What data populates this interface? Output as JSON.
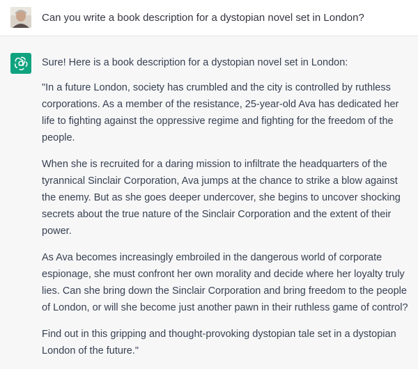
{
  "user_message": {
    "avatar_icon": "user-avatar-photo",
    "text": "Can you write a book description for a dystopian novel set in London?"
  },
  "assistant_message": {
    "avatar_icon": "openai-logo-icon",
    "avatar_color": "#10a37f",
    "intro": "Sure! Here is a book description for a dystopian novel set in London:",
    "paragraphs": [
      "\"In a future London, society has crumbled and the city is controlled by ruthless corporations. As a member of the resistance, 25-year-old Ava has dedicated her life to fighting against the oppressive regime and fighting for the freedom of the people.",
      "When she is recruited for a daring mission to infiltrate the headquarters of the tyrannical Sinclair Corporation, Ava jumps at the chance to strike a blow against the enemy. But as she goes deeper undercover, she begins to uncover shocking secrets about the true nature of the Sinclair Corporation and the extent of their power.",
      "As Ava becomes increasingly embroiled in the dangerous world of corporate espionage, she must confront her own morality and decide where her loyalty truly lies. Can she bring down the Sinclair Corporation and bring freedom to the people of London, or will she become just another pawn in their ruthless game of control?",
      "Find out in this gripping and thought-provoking dystopian tale set in a dystopian London of the future.\""
    ]
  }
}
